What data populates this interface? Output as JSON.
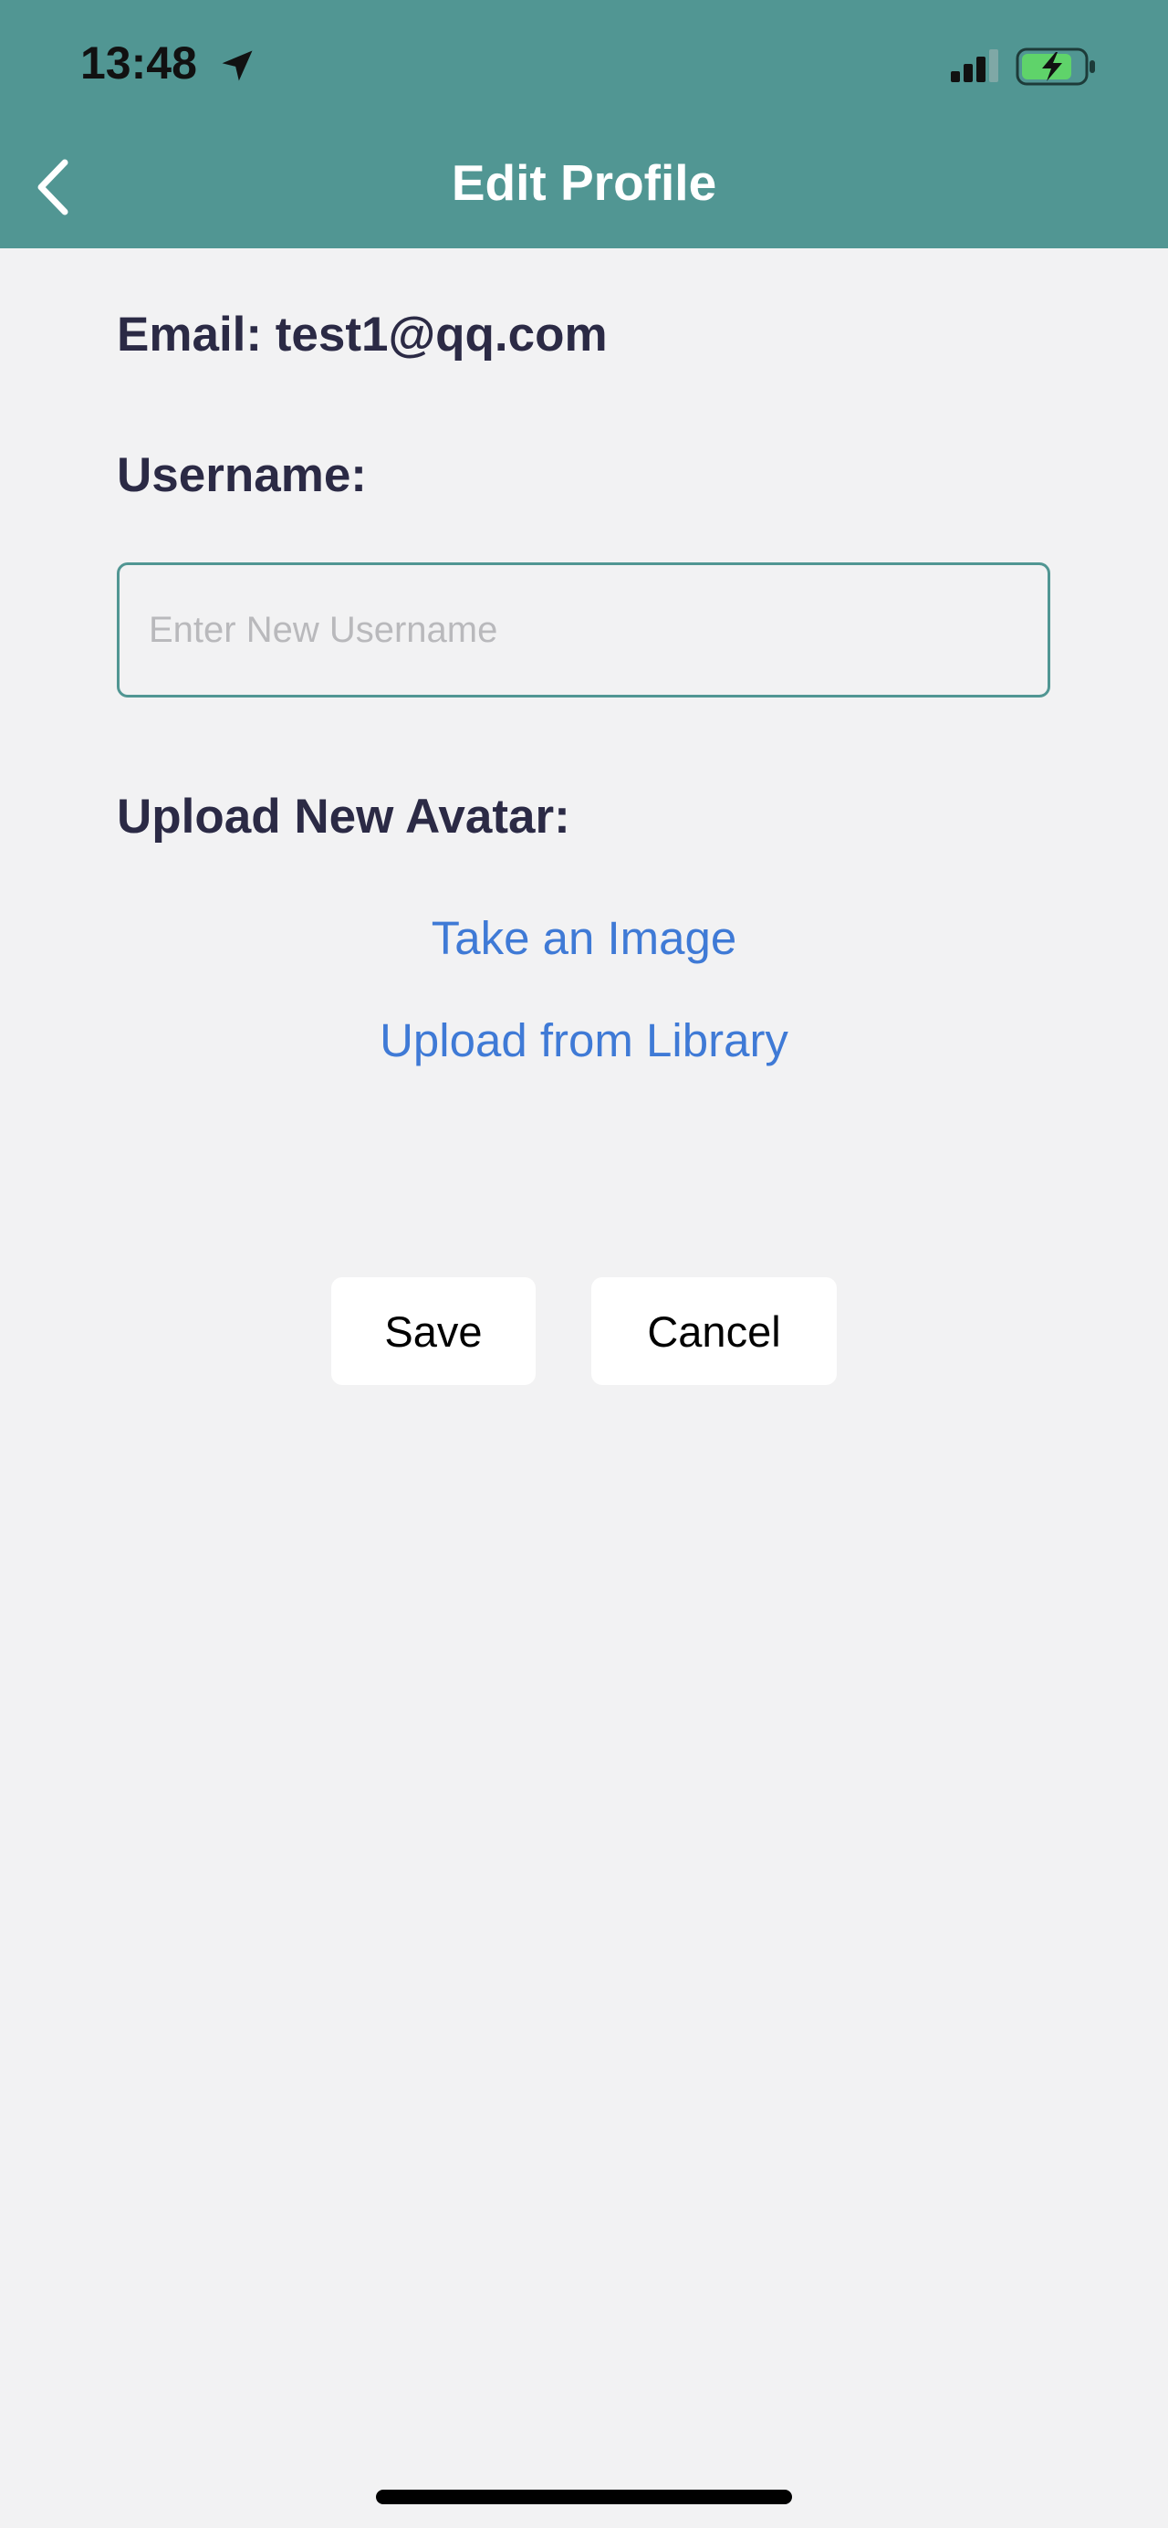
{
  "status_bar": {
    "time": "13:48",
    "icons": [
      "location-arrow-icon",
      "cellular-signal-icon",
      "battery-charging-icon"
    ]
  },
  "header": {
    "title": "Edit Profile",
    "back_icon": "chevron-left-icon",
    "background_color": "#519693"
  },
  "form": {
    "email_label": "Email: test1@qq.com",
    "username_label": "Username:",
    "username_placeholder": "Enter New Username",
    "username_value": "",
    "avatar_label": "Upload New Avatar:",
    "take_image_link": "Take an Image",
    "upload_library_link": "Upload from Library"
  },
  "actions": {
    "save_label": "Save",
    "cancel_label": "Cancel"
  },
  "colors": {
    "accent": "#519693",
    "link": "#3f7ad6",
    "label_text": "#2b2a45",
    "background": "#f2f2f3"
  }
}
